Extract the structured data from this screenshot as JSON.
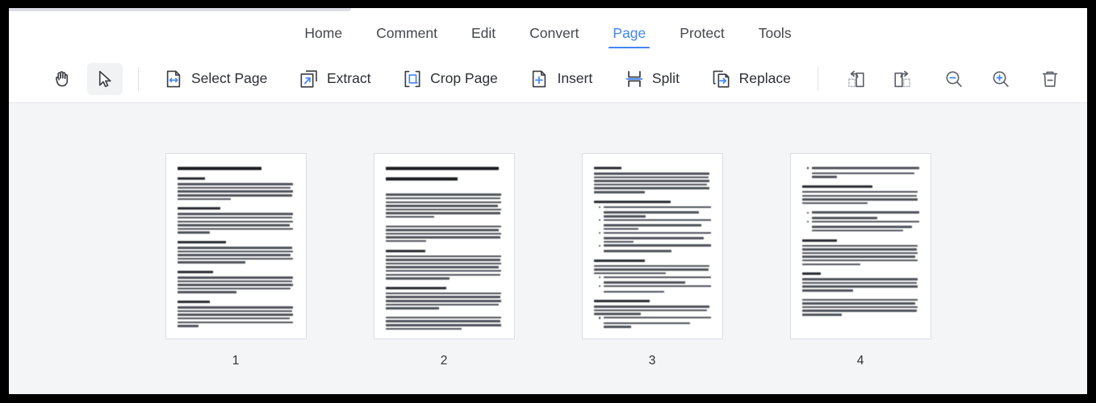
{
  "window": {
    "accent_color": "#4285f4",
    "toolbar_bg": "#ffffff",
    "canvas_bg": "#f4f5f7"
  },
  "menubar": {
    "items": [
      {
        "label": "Home",
        "active": false
      },
      {
        "label": "Comment",
        "active": false
      },
      {
        "label": "Edit",
        "active": false
      },
      {
        "label": "Convert",
        "active": false
      },
      {
        "label": "Page",
        "active": true
      },
      {
        "label": "Protect",
        "active": false
      },
      {
        "label": "Tools",
        "active": false
      }
    ]
  },
  "toolbar": {
    "hand_tool": {
      "icon": "hand-icon",
      "label": ""
    },
    "select_tool": {
      "icon": "cursor-arrow-icon",
      "label": "",
      "selected": true
    },
    "buttons": [
      {
        "label": "Select Page",
        "icon": "select-page-icon"
      },
      {
        "label": "Extract",
        "icon": "extract-icon"
      },
      {
        "label": "Crop Page",
        "icon": "crop-page-icon"
      },
      {
        "label": "Insert",
        "icon": "insert-page-icon"
      },
      {
        "label": "Split",
        "icon": "split-page-icon"
      },
      {
        "label": "Replace",
        "icon": "replace-page-icon"
      }
    ],
    "right_buttons": [
      {
        "label": "",
        "icon": "rotate-left-icon"
      },
      {
        "label": "",
        "icon": "rotate-right-icon"
      },
      {
        "label": "",
        "icon": "zoom-out-icon"
      },
      {
        "label": "",
        "icon": "zoom-in-icon"
      },
      {
        "label": "",
        "icon": "delete-page-icon"
      }
    ]
  },
  "pages": [
    {
      "number": "1",
      "title": "Benefits of Cysteine Hair Treatments",
      "sections": [
        "Healthy Hair",
        "Suits Hair with Hair Types",
        "Very Good Keratin Treatment",
        "Long-Lasting Results",
        "Without Breakage"
      ]
    },
    {
      "number": "2",
      "title": "Why Cysteine Hair Treatments Are the Best Choice for Healthy Hair Relaxation?",
      "sections": [
        "What is Cysteine?",
        "How Cysteine Hair Treatment Works?"
      ]
    },
    {
      "number": "3",
      "title": "Better Texture",
      "sections": [
        "Cysteine Hair Treatment Process - Step by Step",
        "Cysteine vs. Keratin Treatments",
        "Cysteine vs. Traditional Relaxers"
      ]
    },
    {
      "number": "4",
      "title": "",
      "sections": [
        "Cysteine vs. Japanese Hair Straightening",
        "Shopping & Lip",
        "FAQs"
      ]
    }
  ]
}
